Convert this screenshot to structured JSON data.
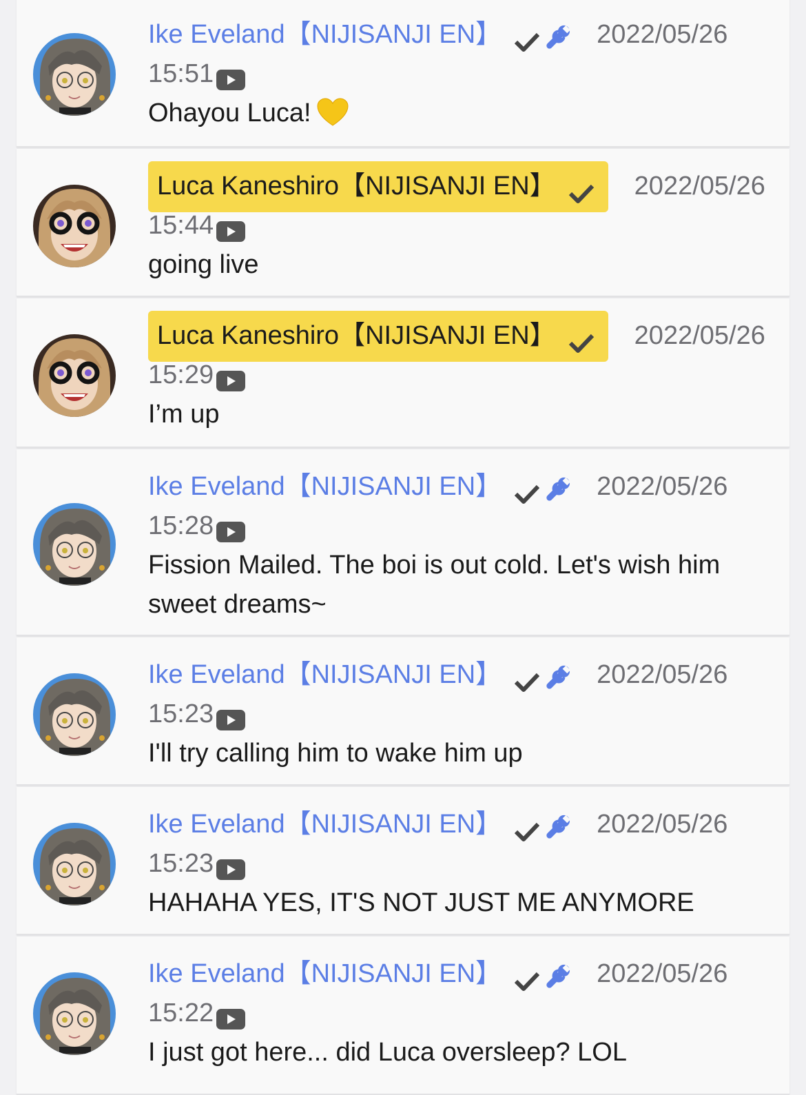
{
  "colors": {
    "author_name": "#5b7ee5",
    "owner_highlight": "#f7d94c",
    "timestamp": "#6e6e73",
    "message": "#1a1a1a",
    "card_background": "#f9f9f9"
  },
  "messages": [
    {
      "author": "Ike Eveland【NIJISANJI EN】",
      "author_type": "moderator",
      "badges": [
        "check-icon",
        "wrench-icon"
      ],
      "date": "2022/05/26",
      "time": "15:51",
      "text": "Ohayou Luca!",
      "emoji": "yellow-heart-icon",
      "avatar": "ike-avatar"
    },
    {
      "author": "Luca Kaneshiro【NIJISANJI EN】",
      "author_type": "owner",
      "badges": [
        "check-icon"
      ],
      "date": "2022/05/26",
      "time": "15:44",
      "text": "going live",
      "avatar": "luca-avatar"
    },
    {
      "author": "Luca Kaneshiro【NIJISANJI EN】",
      "author_type": "owner",
      "badges": [
        "check-icon"
      ],
      "date": "2022/05/26",
      "time": "15:29",
      "text": "I’m up",
      "avatar": "luca-avatar"
    },
    {
      "author": "Ike Eveland【NIJISANJI EN】",
      "author_type": "moderator",
      "badges": [
        "check-icon",
        "wrench-icon"
      ],
      "date": "2022/05/26",
      "time": "15:28",
      "text": "Fission Mailed. The boi is out cold. Let's wish him sweet dreams~",
      "avatar": "ike-avatar"
    },
    {
      "author": "Ike Eveland【NIJISANJI EN】",
      "author_type": "moderator",
      "badges": [
        "check-icon",
        "wrench-icon"
      ],
      "date": "2022/05/26",
      "time": "15:23",
      "text": "I'll try calling him to wake him up",
      "avatar": "ike-avatar"
    },
    {
      "author": "Ike Eveland【NIJISANJI EN】",
      "author_type": "moderator",
      "badges": [
        "check-icon",
        "wrench-icon"
      ],
      "date": "2022/05/26",
      "time": "15:23",
      "text": "HAHAHA YES, IT'S NOT JUST ME ANYMORE",
      "avatar": "ike-avatar"
    },
    {
      "author": "Ike Eveland【NIJISANJI EN】",
      "author_type": "moderator",
      "badges": [
        "check-icon",
        "wrench-icon"
      ],
      "date": "2022/05/26",
      "time": "15:22",
      "text": "I just got here... did Luca oversleep? LOL",
      "avatar": "ike-avatar"
    }
  ]
}
